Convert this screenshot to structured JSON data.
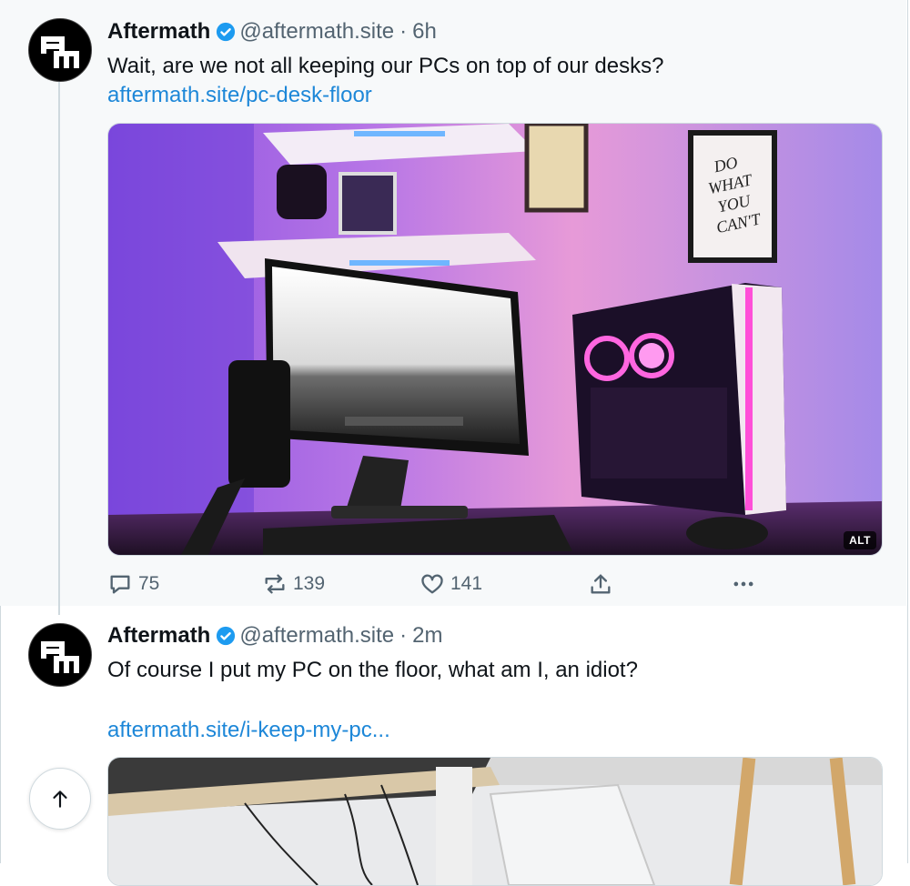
{
  "posts": [
    {
      "author_name": "Aftermath",
      "handle": "@aftermath.site",
      "separator": "·",
      "time": "6h",
      "text": "Wait, are we not all keeping our PCs on top of our desks?",
      "link": "aftermath.site/pc-desk-floor",
      "image_alt_badge": "ALT",
      "poster_text": "DO WHAT YOU CAN'T",
      "stats": {
        "replies": "75",
        "reposts": "139",
        "likes": "141"
      }
    },
    {
      "author_name": "Aftermath",
      "handle": "@aftermath.site",
      "separator": "·",
      "time": "2m",
      "text": "Of course I put my PC on the floor, what am I, an idiot?",
      "link": "aftermath.site/i-keep-my-pc..."
    }
  ],
  "icons": {
    "verified": "verified-badge-icon",
    "reply": "reply-icon",
    "repost": "repost-icon",
    "like": "heart-icon",
    "share": "share-icon",
    "more": "more-icon",
    "scroll_top": "arrow-up-icon"
  },
  "colors": {
    "link": "#1d87d8",
    "verified": "#1d9bf0",
    "muted": "#536471"
  }
}
